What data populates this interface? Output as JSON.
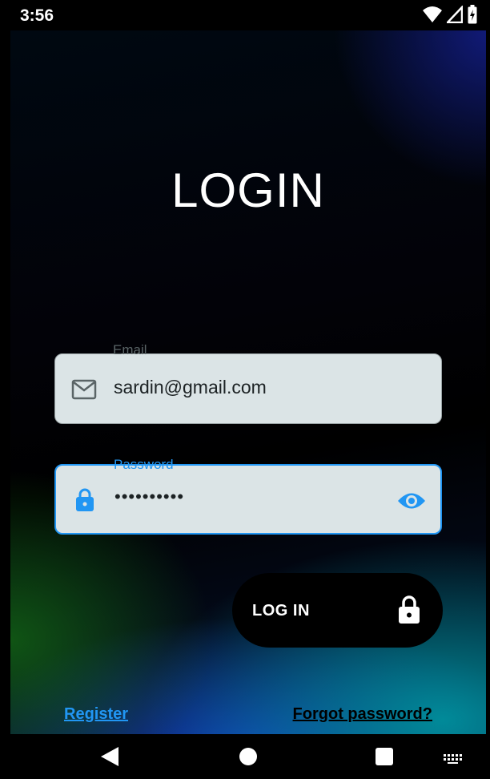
{
  "status_bar": {
    "time": "3:56",
    "icons": [
      "wifi-icon",
      "signal-icon",
      "battery-icon"
    ]
  },
  "login": {
    "title": "LOGIN",
    "email": {
      "label": "Email",
      "value": "sardin@gmail.com",
      "icon": "mail-icon"
    },
    "password": {
      "label": "Password",
      "value": "••••••••••",
      "icon": "lock-icon",
      "toggle_icon": "eye-icon"
    },
    "submit_button": {
      "label": "LOG IN",
      "icon": "lock-icon"
    },
    "register_link": "Register",
    "forgot_link": "Forgot password?"
  },
  "nav_bar": {
    "icons": [
      "back-icon",
      "home-icon",
      "recents-icon",
      "keyboard-icon"
    ]
  },
  "colors": {
    "accent": "#2196f3",
    "field_background": "#dbe4e6",
    "button_background": "#000000"
  }
}
